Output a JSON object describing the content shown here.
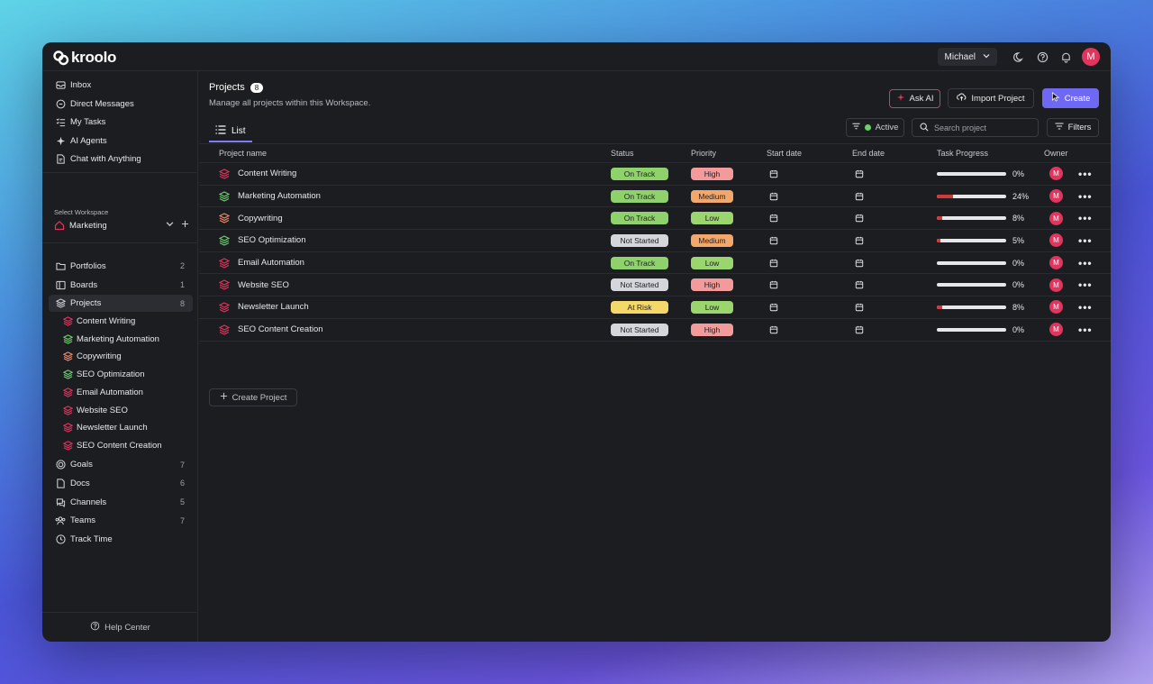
{
  "app": {
    "logo_text": "kroolo"
  },
  "topbar": {
    "user_name": "Michael",
    "avatar_letter": "M"
  },
  "sidebar": {
    "top_items": [
      {
        "label": "Inbox",
        "icon": "inbox-icon"
      },
      {
        "label": "Direct Messages",
        "icon": "chat-bubble-icon"
      },
      {
        "label": "My Tasks",
        "icon": "task-list-icon"
      },
      {
        "label": "AI Agents",
        "icon": "sparkle-icon"
      },
      {
        "label": "Chat with Anything",
        "icon": "document-chat-icon"
      }
    ],
    "workspace_label": "Select Workspace",
    "workspace_name": "Marketing",
    "nav_items": [
      {
        "label": "Portfolios",
        "count": "2",
        "icon": "folder-icon"
      },
      {
        "label": "Boards",
        "count": "1",
        "icon": "board-icon"
      },
      {
        "label": "Projects",
        "count": "8",
        "icon": "layers-icon"
      }
    ],
    "project_items": [
      {
        "label": "Content Writing",
        "color": "#e2345d"
      },
      {
        "label": "Marketing Automation",
        "color": "#6ecf6e"
      },
      {
        "label": "Copywriting",
        "color": "#f08a6a"
      },
      {
        "label": "SEO Optimization",
        "color": "#6ecf6e"
      },
      {
        "label": "Email Automation",
        "color": "#e2345d"
      },
      {
        "label": "Website SEO",
        "color": "#e2345d"
      },
      {
        "label": "Newsletter Launch",
        "color": "#e2345d"
      },
      {
        "label": "SEO Content Creation",
        "color": "#e2345d"
      }
    ],
    "bottom_items": [
      {
        "label": "Goals",
        "count": "7",
        "icon": "target-icon"
      },
      {
        "label": "Docs",
        "count": "6",
        "icon": "doc-icon"
      },
      {
        "label": "Channels",
        "count": "5",
        "icon": "channels-icon"
      },
      {
        "label": "Teams",
        "count": "7",
        "icon": "team-icon"
      },
      {
        "label": "Track Time",
        "count": "",
        "icon": "clock-icon"
      }
    ],
    "help_label": "Help Center"
  },
  "header": {
    "title": "Projects",
    "count": "8",
    "subtitle": "Manage all projects within this Workspace.",
    "ask_ai_label": "Ask AI",
    "import_label": "Import Project",
    "create_label": "Create"
  },
  "toolbar": {
    "tab_list_label": "List",
    "active_filter_label": "Active",
    "search_placeholder": "Search project",
    "filters_label": "Filters"
  },
  "table": {
    "columns": [
      "Project name",
      "Status",
      "Priority",
      "Start date",
      "End date",
      "Task Progress",
      "Owner"
    ],
    "rows": [
      {
        "name": "Content Writing",
        "icon_color": "#e2345d",
        "status": "On Track",
        "status_color": "#8fd16a",
        "priority": "High",
        "priority_color": "#f39a9a",
        "progress": 0,
        "progress_label": "0%",
        "owner": "M"
      },
      {
        "name": "Marketing Automation",
        "icon_color": "#6ecf6e",
        "status": "On Track",
        "status_color": "#8fd16a",
        "priority": "Medium",
        "priority_color": "#f4a76a",
        "progress": 24,
        "progress_label": "24%",
        "owner": "M"
      },
      {
        "name": "Copywriting",
        "icon_color": "#f08a6a",
        "status": "On Track",
        "status_color": "#8fd16a",
        "priority": "Low",
        "priority_color": "#9bd56e",
        "progress": 8,
        "progress_label": "8%",
        "owner": "M"
      },
      {
        "name": "SEO Optimization",
        "icon_color": "#6ecf6e",
        "status": "Not Started",
        "status_color": "#d4d6db",
        "priority": "Medium",
        "priority_color": "#f4a76a",
        "progress": 5,
        "progress_label": "5%",
        "owner": "M"
      },
      {
        "name": "Email Automation",
        "icon_color": "#e2345d",
        "status": "On Track",
        "status_color": "#8fd16a",
        "priority": "Low",
        "priority_color": "#9bd56e",
        "progress": 0,
        "progress_label": "0%",
        "owner": "M"
      },
      {
        "name": "Website SEO",
        "icon_color": "#e2345d",
        "status": "Not Started",
        "status_color": "#d4d6db",
        "priority": "High",
        "priority_color": "#f39a9a",
        "progress": 0,
        "progress_label": "0%",
        "owner": "M"
      },
      {
        "name": "Newsletter Launch",
        "icon_color": "#e2345d",
        "status": "At Risk",
        "status_color": "#f5d86a",
        "priority": "Low",
        "priority_color": "#9bd56e",
        "progress": 8,
        "progress_label": "8%",
        "owner": "M"
      },
      {
        "name": "SEO Content Creation",
        "icon_color": "#e2345d",
        "status": "Not Started",
        "status_color": "#d4d6db",
        "priority": "High",
        "priority_color": "#f39a9a",
        "progress": 0,
        "progress_label": "0%",
        "owner": "M"
      }
    ],
    "create_project_label": "Create Project"
  },
  "colors": {
    "accent": "#6e68f2",
    "avatar": "#e2345d",
    "progress": "#d23a3a"
  }
}
